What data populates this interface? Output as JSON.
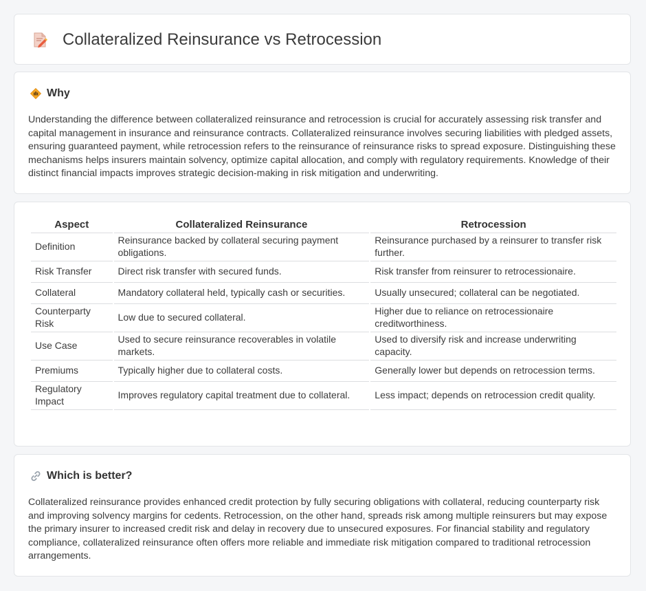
{
  "header": {
    "title": "Collateralized Reinsurance vs Retrocession",
    "icon": "document-edit-icon"
  },
  "why": {
    "heading": "Why",
    "icon": "diamond-sign-icon",
    "text": "Understanding the difference between collateralized reinsurance and retrocession is crucial for accurately assessing risk transfer and capital management in insurance and reinsurance contracts. Collateralized reinsurance involves securing liabilities with pledged assets, ensuring guaranteed payment, while retrocession refers to the reinsurance of reinsurance risks to spread exposure. Distinguishing these mechanisms helps insurers maintain solvency, optimize capital allocation, and comply with regulatory requirements. Knowledge of their distinct financial impacts improves strategic decision-making in risk mitigation and underwriting."
  },
  "table": {
    "headers": [
      "Aspect",
      "Collateralized Reinsurance",
      "Retrocession"
    ],
    "rows": [
      [
        "Definition",
        "Reinsurance backed by collateral securing payment obligations.",
        "Reinsurance purchased by a reinsurer to transfer risk further."
      ],
      [
        "Risk Transfer",
        "Direct risk transfer with secured funds.",
        "Risk transfer from reinsurer to retrocessionaire."
      ],
      [
        "Collateral",
        "Mandatory collateral held, typically cash or securities.",
        "Usually unsecured; collateral can be negotiated."
      ],
      [
        "Counterparty Risk",
        "Low due to secured collateral.",
        "Higher due to reliance on retrocessionaire creditworthiness."
      ],
      [
        "Use Case",
        "Used to secure reinsurance recoverables in volatile markets.",
        "Used to diversify risk and increase underwriting capacity."
      ],
      [
        "Premiums",
        "Typically higher due to collateral costs.",
        "Generally lower but depends on retrocession terms."
      ],
      [
        "Regulatory Impact",
        "Improves regulatory capital treatment due to collateral.",
        "Less impact; depends on retrocession credit quality."
      ]
    ]
  },
  "better": {
    "heading": "Which is better?",
    "icon": "link-icon",
    "text": "Collateralized reinsurance provides enhanced credit protection by fully securing obligations with collateral, reducing counterparty risk and improving solvency margins for cedents. Retrocession, on the other hand, spreads risk among multiple reinsurers but may expose the primary insurer to increased credit risk and delay in recovery due to unsecured exposures. For financial stability and regulatory compliance, collateralized reinsurance often offers more reliable and immediate risk mitigation compared to traditional retrocession arrangements."
  }
}
